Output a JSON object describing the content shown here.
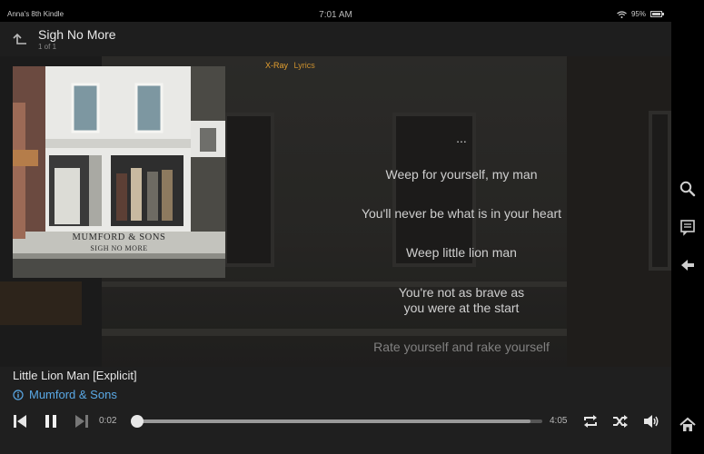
{
  "status_bar": {
    "device_name": "Anna's 8th Kindle",
    "time": "7:01 AM",
    "battery": "95%"
  },
  "header": {
    "title": "Sigh No More",
    "subtitle": "1 of 1"
  },
  "album": {
    "band": "MUMFORD & SONS",
    "album_title": "SIGH NO MORE"
  },
  "tabs": [
    {
      "label": "X-Ray"
    },
    {
      "label": "Lyrics"
    }
  ],
  "lyrics": [
    "...",
    "Weep for yourself, my man",
    "You'll never be what is in your heart",
    "Weep little lion man",
    "You're not as brave as",
    "you were at the start",
    "Rate yourself and rake yourself"
  ],
  "player": {
    "song_title": "Little Lion Man [Explicit]",
    "artist": "Mumford & Sons",
    "elapsed": "0:02",
    "duration": "4:05",
    "progress_fraction": 0.008,
    "buffered_fraction": 0.97
  },
  "icons": {
    "back": "back-arrow-icon",
    "search": "search-icon",
    "notes": "notes-icon",
    "rail_back": "back-icon",
    "home": "home-icon",
    "info": "info-icon",
    "wifi": "wifi-icon",
    "battery": "battery-icon"
  },
  "colors": {
    "accent_tab": "#e5a030",
    "artist_link": "#5aa9e6"
  }
}
